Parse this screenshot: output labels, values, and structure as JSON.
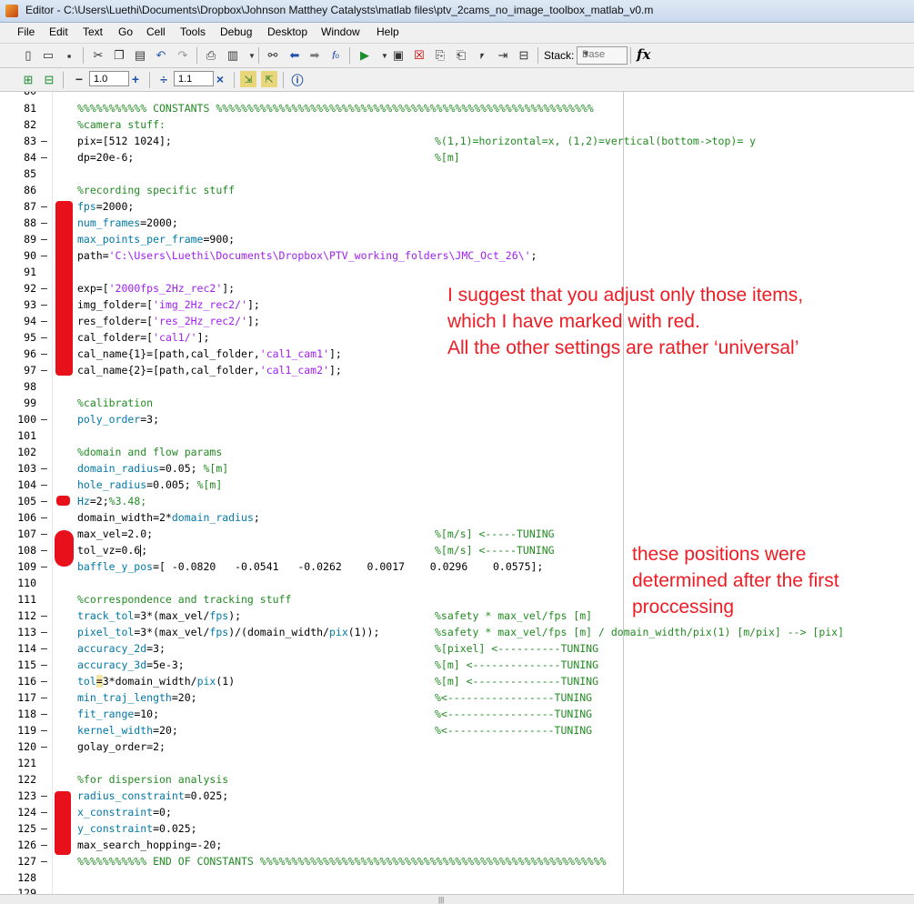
{
  "window": {
    "title": "Editor - C:\\Users\\Luethi\\Documents\\Dropbox\\Johnson Matthey Catalysts\\matlab files\\ptv_2cams_no_image_toolbox_matlab_v0.m"
  },
  "menu": [
    "File",
    "Edit",
    "Text",
    "Go",
    "Cell",
    "Tools",
    "Debug",
    "Desktop",
    "Window",
    "Help"
  ],
  "toolbar": {
    "stack_label": "Stack:",
    "stack_value": "Base",
    "fx": "fx",
    "minus": "−",
    "plus": "+",
    "cell_value1": "1.0",
    "divide": "÷",
    "cell_value2": "1.1",
    "times": "×"
  },
  "code": {
    "top_partial": "80",
    "bottom_partial": "129",
    "lines": [
      {
        "n": "81",
        "d": "",
        "t": "%%%%%%%%%%% CONSTANTS %%%%%%%%%%%%%%%%%%%%%%%%%%%%%%%%%%%%%%%%%%%%%%%%%%%%%%%%%%%%",
        "c": ""
      },
      {
        "n": "82",
        "d": "",
        "t": "%camera stuff:",
        "c": ""
      },
      {
        "n": "83",
        "d": "–",
        "t": "pix=[512 1024];",
        "c": "%(1,1)=horizontal=x, (1,2)=vertical(bottom->top)= y"
      },
      {
        "n": "84",
        "d": "–",
        "t": "dp=20e-6;",
        "c": "%[m]"
      },
      {
        "n": "85",
        "d": "",
        "t": "",
        "c": ""
      },
      {
        "n": "86",
        "d": "",
        "t": "%recording specific stuff",
        "c": ""
      },
      {
        "n": "87",
        "d": "–",
        "t": "fps=2000;",
        "c": ""
      },
      {
        "n": "88",
        "d": "–",
        "t": "num_frames=2000;",
        "c": ""
      },
      {
        "n": "89",
        "d": "–",
        "t": "max_points_per_frame=900;",
        "c": ""
      },
      {
        "n": "90",
        "d": "–",
        "t": "path='C:\\Users\\Luethi\\Documents\\Dropbox\\PTV_working_folders\\JMC_Oct_26\\';",
        "c": ""
      },
      {
        "n": "91",
        "d": "",
        "t": "",
        "c": ""
      },
      {
        "n": "92",
        "d": "–",
        "t": "exp=['2000fps_2Hz_rec2'];",
        "c": ""
      },
      {
        "n": "93",
        "d": "–",
        "t": "img_folder=['img_2Hz_rec2/'];",
        "c": ""
      },
      {
        "n": "94",
        "d": "–",
        "t": "res_folder=['res_2Hz_rec2/'];",
        "c": ""
      },
      {
        "n": "95",
        "d": "–",
        "t": "cal_folder=['cal1/'];",
        "c": ""
      },
      {
        "n": "96",
        "d": "–",
        "t": "cal_name{1}=[path,cal_folder,'cal1_cam1'];",
        "c": ""
      },
      {
        "n": "97",
        "d": "–",
        "t": "cal_name{2}=[path,cal_folder,'cal1_cam2'];",
        "c": ""
      },
      {
        "n": "98",
        "d": "",
        "t": "",
        "c": ""
      },
      {
        "n": "99",
        "d": "",
        "t": "%calibration",
        "c": ""
      },
      {
        "n": "100",
        "d": "–",
        "t": "poly_order=3;",
        "c": ""
      },
      {
        "n": "101",
        "d": "",
        "t": "",
        "c": ""
      },
      {
        "n": "102",
        "d": "",
        "t": "%domain and flow params",
        "c": ""
      },
      {
        "n": "103",
        "d": "–",
        "t": "domain_radius=0.05; %[m]",
        "c": ""
      },
      {
        "n": "104",
        "d": "–",
        "t": "hole_radius=0.005; %[m]",
        "c": ""
      },
      {
        "n": "105",
        "d": "–",
        "t": "Hz=2;%3.48;",
        "c": ""
      },
      {
        "n": "106",
        "d": "–",
        "t": "domain_width=2*domain_radius;",
        "c": ""
      },
      {
        "n": "107",
        "d": "–",
        "t": "max_vel=2.0;",
        "c": "%[m/s] <-----TUNING"
      },
      {
        "n": "108",
        "d": "–",
        "t": "tol_vz=0.6;",
        "c": "%[m/s] <-----TUNING"
      },
      {
        "n": "109",
        "d": "–",
        "t": "baffle_y_pos=[ -0.0820   -0.0541   -0.0262    0.0017    0.0296    0.0575];",
        "c": ""
      },
      {
        "n": "110",
        "d": "",
        "t": "",
        "c": ""
      },
      {
        "n": "111",
        "d": "",
        "t": "%correspondence and tracking stuff",
        "c": ""
      },
      {
        "n": "112",
        "d": "–",
        "t": "track_tol=3*(max_vel/fps);",
        "c": "%safety * max_vel/fps [m]"
      },
      {
        "n": "113",
        "d": "–",
        "t": "pixel_tol=3*(max_vel/fps)/(domain_width/pix(1));",
        "c": "%safety * max_vel/fps [m] / domain_width/pix(1) [m/pix] --> [pix]"
      },
      {
        "n": "114",
        "d": "–",
        "t": "accuracy_2d=3;",
        "c": "%[pixel] <----------TUNING"
      },
      {
        "n": "115",
        "d": "–",
        "t": "accuracy_3d=5e-3;",
        "c": "%[m] <--------------TUNING"
      },
      {
        "n": "116",
        "d": "–",
        "t": "tol=3*domain_width/pix(1)",
        "c": "%[m] <--------------TUNING"
      },
      {
        "n": "117",
        "d": "–",
        "t": "min_traj_length=20;",
        "c": "%<-----------------TUNING"
      },
      {
        "n": "118",
        "d": "–",
        "t": "fit_range=10;",
        "c": "%<-----------------TUNING"
      },
      {
        "n": "119",
        "d": "–",
        "t": "kernel_width=20;",
        "c": "%<-----------------TUNING"
      },
      {
        "n": "120",
        "d": "–",
        "t": "golay_order=2;",
        "c": ""
      },
      {
        "n": "121",
        "d": "",
        "t": "",
        "c": ""
      },
      {
        "n": "122",
        "d": "",
        "t": "%for dispersion analysis",
        "c": ""
      },
      {
        "n": "123",
        "d": "–",
        "t": "radius_constraint=0.025;",
        "c": ""
      },
      {
        "n": "124",
        "d": "–",
        "t": "x_constraint=0;",
        "c": ""
      },
      {
        "n": "125",
        "d": "–",
        "t": "y_constraint=0.025;",
        "c": ""
      },
      {
        "n": "126",
        "d": "–",
        "t": "max_search_hopping=-20;",
        "c": ""
      },
      {
        "n": "127",
        "d": "–",
        "t": "%%%%%%%%%%% END OF CONSTANTS %%%%%%%%%%%%%%%%%%%%%%%%%%%%%%%%%%%%%%%%%%%%%%%%%%%%%%%",
        "c": ""
      },
      {
        "n": "128",
        "d": "",
        "t": "",
        "c": ""
      }
    ]
  },
  "annotations": {
    "note1": [
      "I suggest that you adjust only those items,",
      "which I have marked with red.",
      "All the other settings are rather ‘universal’"
    ],
    "note2": [
      "these positions were",
      "determined after the first",
      "proccessing"
    ]
  },
  "colors": {
    "comment": "#228b22",
    "string": "#a020f0",
    "variable": "#0078a8",
    "annotation": "#ee1c24",
    "marker": "#e8101a"
  }
}
